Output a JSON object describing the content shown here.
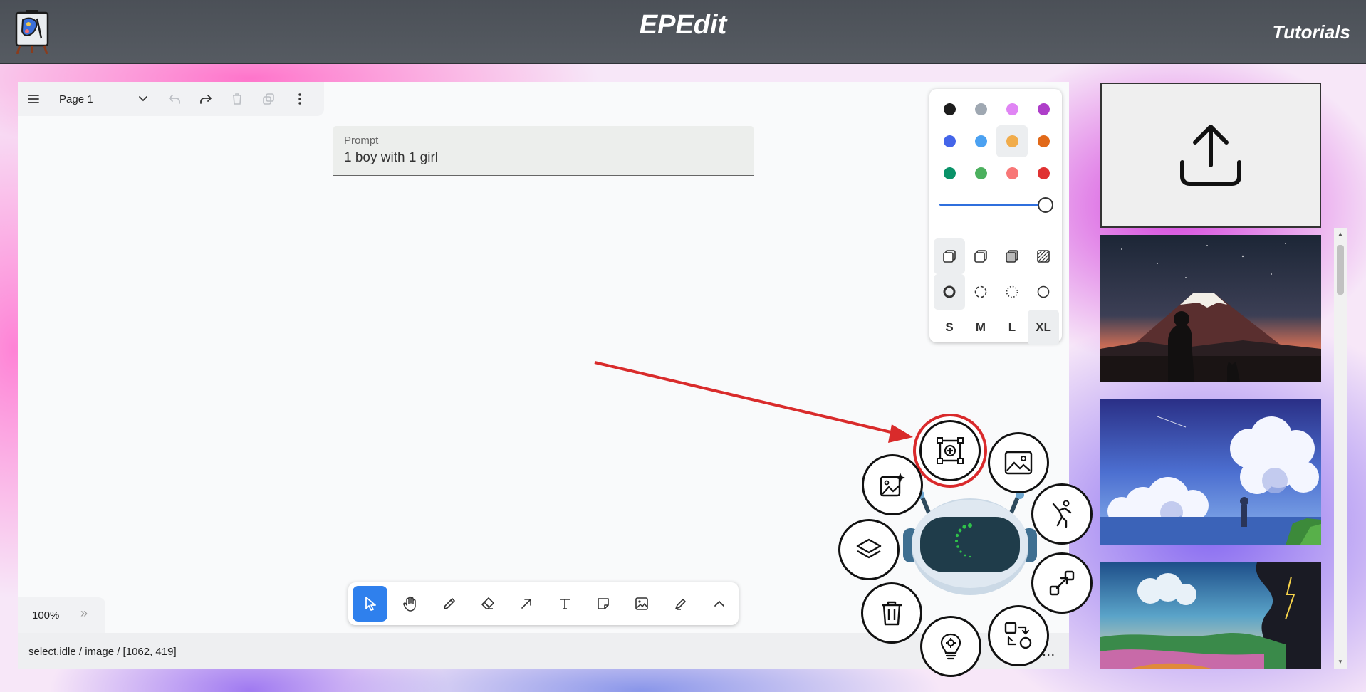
{
  "header": {
    "title": "EPEdit",
    "tutorials_label": "Tutorials"
  },
  "page_bar": {
    "page_label": "Page 1"
  },
  "prompt": {
    "label": "Prompt",
    "value": "1 boy with 1 girl"
  },
  "style_panel": {
    "colors": [
      "#1d1d1d",
      "#9fa8b2",
      "#e085f4",
      "#ae3ec9",
      "#4465e9",
      "#4ba1f1",
      "#f1ac4b",
      "#e16919",
      "#099268",
      "#4cb05e",
      "#f87777",
      "#e03131"
    ],
    "selected_color": "#f1ac4b",
    "opacity_percent": 100,
    "fill_icons": [
      "fill-none-icon",
      "fill-semi-icon",
      "fill-solid-icon",
      "fill-pattern-icon"
    ],
    "dash_icons": [
      "dash-draw-icon",
      "dash-dashed-icon",
      "dash-dotted-icon",
      "dash-solid-icon"
    ],
    "sizes": [
      "S",
      "M",
      "L",
      "XL"
    ],
    "selected_size": "XL"
  },
  "toolbar": {
    "tools": [
      "select-icon",
      "hand-icon",
      "pencil-icon",
      "eraser-icon",
      "arrow-icon",
      "text-icon",
      "note-icon",
      "image-icon",
      "highlighter-icon",
      "chevron-up-icon"
    ],
    "active_tool": "select-icon"
  },
  "zoom": {
    "value": "100%",
    "expand": "»"
  },
  "status_bar": {
    "text": "select.idle / image / [1062, 419]",
    "more": "..."
  },
  "robot_menu": {
    "buttons": [
      "frame-add-icon",
      "image-gallery-icon",
      "ai-image-sparkle-icon",
      "pose-figure-icon",
      "layers-icon",
      "resize-arrows-icon",
      "trash-icon",
      "shape-convert-icon",
      "lightbulb-gear-icon"
    ],
    "highlighted": "frame-add-icon"
  },
  "gallery": {
    "upload_icon": "upload-icon",
    "thumbnails": [
      "Mount Fuji sunset with silhouette of person and cat",
      "Girl standing by the sea under cumulus clouds",
      "Colorful landscape with storm clouds"
    ]
  }
}
